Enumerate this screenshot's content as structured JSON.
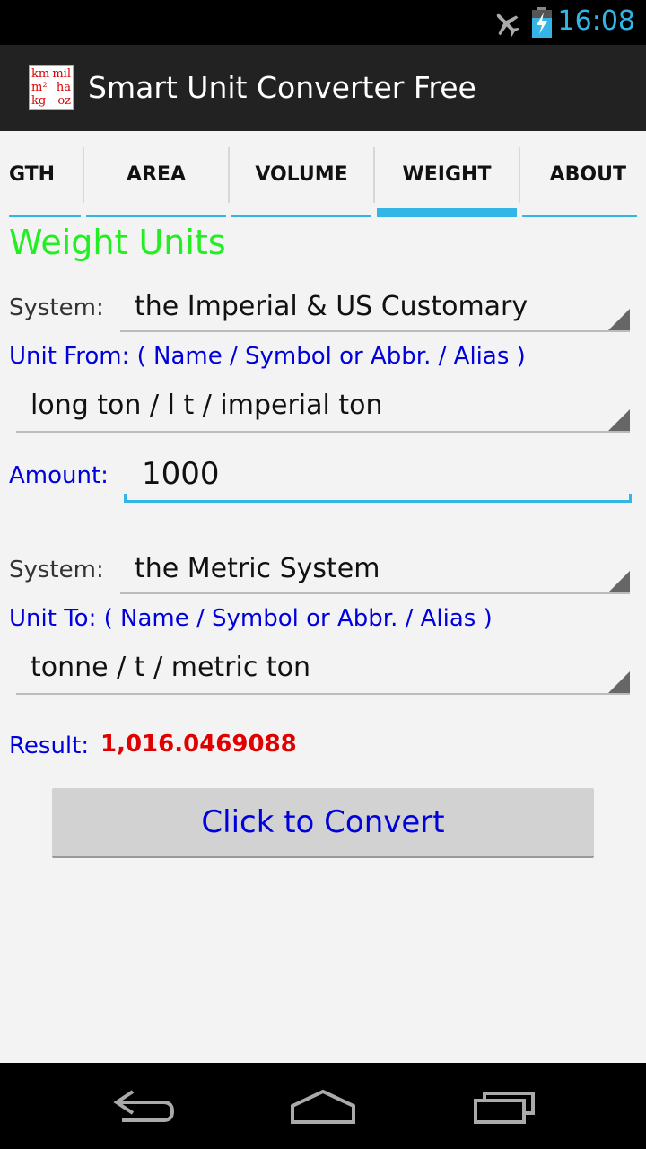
{
  "status_bar": {
    "time": "16:08",
    "icons": [
      "airplane-mode-icon",
      "battery-charging-icon"
    ],
    "time_color": "#33b5e5"
  },
  "action_bar": {
    "title": "Smart Unit Converter Free",
    "logo_text": [
      "km",
      "mil",
      "m²",
      "ha",
      "kg",
      "oz"
    ]
  },
  "tabs": [
    {
      "label": "GTH",
      "active": false
    },
    {
      "label": "AREA",
      "active": false
    },
    {
      "label": "VOLUME",
      "active": false
    },
    {
      "label": "WEIGHT",
      "active": true
    },
    {
      "label": "ABOUT",
      "active": false
    }
  ],
  "form": {
    "section_title": "Weight Units",
    "from_system_label": "System:",
    "from_system_value": "the Imperial & US Customary",
    "unit_from_label": "Unit From: ( Name / Symbol or Abbr. / Alias )",
    "unit_from_value": "long ton / l t / imperial ton",
    "amount_label": "Amount:",
    "amount_value": "1000",
    "to_system_label": "System:",
    "to_system_value": "the Metric System",
    "unit_to_label": "Unit To: ( Name / Symbol or Abbr. / Alias )",
    "unit_to_value": "tonne / t / metric ton",
    "result_label": "Result:",
    "result_value": "1,016.0469088",
    "convert_button": "Click to Convert"
  },
  "nav_bar": {
    "buttons": [
      "back-icon",
      "home-icon",
      "recent-apps-icon"
    ]
  },
  "colors": {
    "accent": "#33b5e5",
    "title_green": "#22ee22",
    "label_blue": "#0000dd",
    "result_red": "#e00000"
  }
}
